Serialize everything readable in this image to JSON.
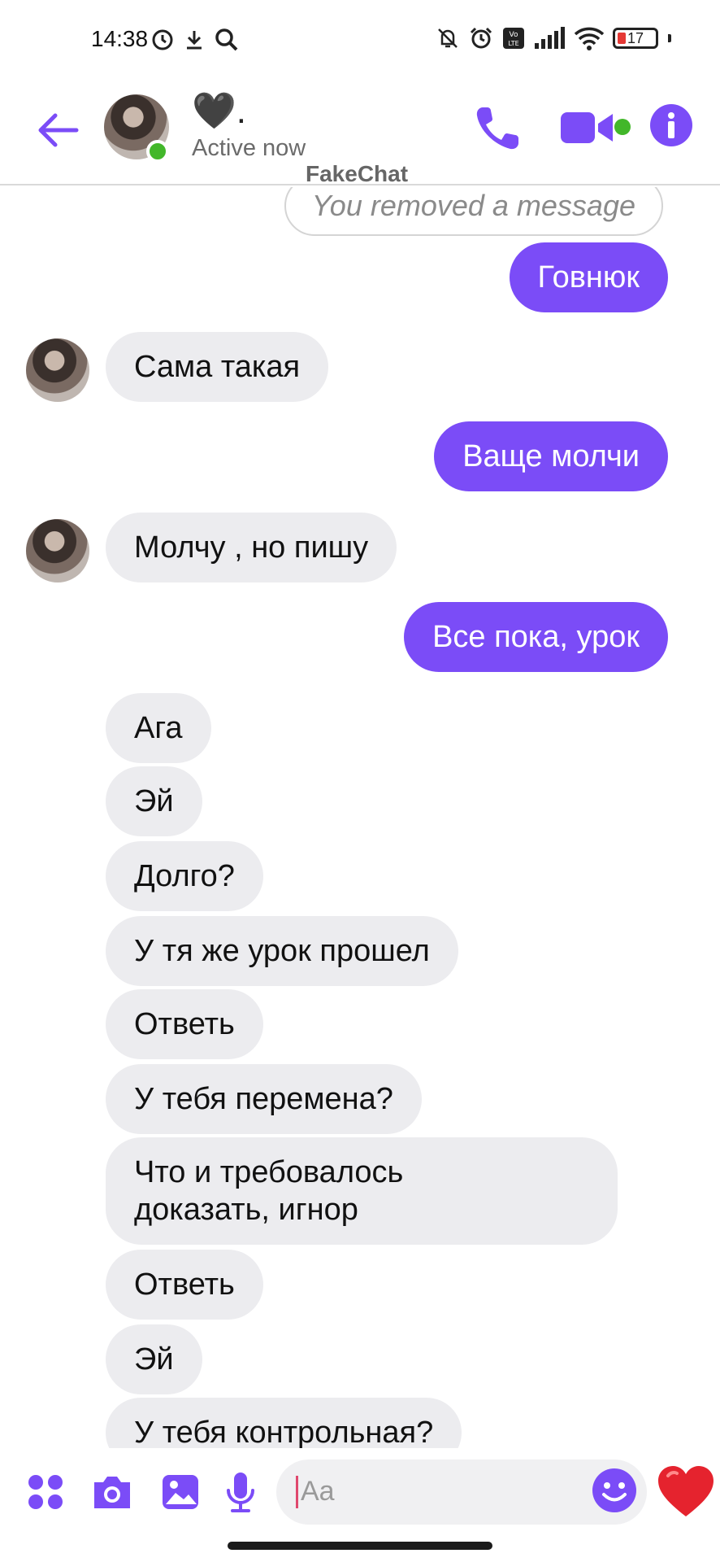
{
  "status_bar": {
    "time": "14:38",
    "battery_level": "17"
  },
  "header": {
    "contact_name": "🖤.",
    "status": "Active now"
  },
  "watermark": "FakeChat",
  "messages": [
    {
      "dir": "removed",
      "text": "You removed a message"
    },
    {
      "dir": "out",
      "text": "Говнюк"
    },
    {
      "dir": "in",
      "text": "Сама такая"
    },
    {
      "dir": "out",
      "text": "Ваще молчи"
    },
    {
      "dir": "in",
      "text": "Молчу , но пишу"
    },
    {
      "dir": "out",
      "text": "Все пока, урок"
    },
    {
      "dir": "in",
      "text": "Ага"
    },
    {
      "dir": "in",
      "text": "Эй"
    },
    {
      "dir": "in",
      "text": "Долго?"
    },
    {
      "dir": "in",
      "text": "У тя же урок прошел"
    },
    {
      "dir": "in",
      "text": "Ответь"
    },
    {
      "dir": "in",
      "text": "У тебя перемена?"
    },
    {
      "dir": "in",
      "text": "Что и требовалось"
    },
    {
      "dir": "in",
      "text": "доказать, игнор"
    },
    {
      "dir": "in",
      "text": "Ответь"
    },
    {
      "dir": "in",
      "text": "Эй"
    },
    {
      "dir": "in",
      "text": "У тебя контрольная?"
    }
  ],
  "composer": {
    "placeholder": "Aa"
  },
  "colors": {
    "accent": "#7b4cf7",
    "incoming_bubble": "#ececef",
    "online": "#42b72a"
  }
}
